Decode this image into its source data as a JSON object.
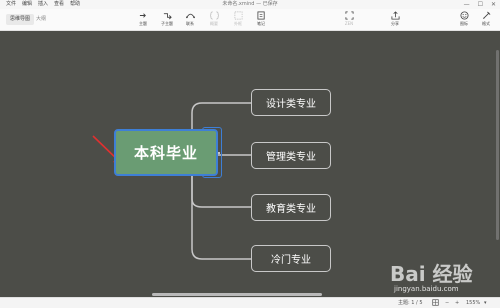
{
  "menubar": {
    "items": [
      "文件",
      "编辑",
      "插入",
      "查看",
      "帮助"
    ],
    "title": "未命名.xmind — 已保存",
    "controls": {
      "minimize": "—",
      "maximize": "☐",
      "close": "✕"
    }
  },
  "toolbar": {
    "view_tabs": [
      "思维导图",
      "大纲"
    ],
    "tools": [
      {
        "label": "主题",
        "icon": "topic-icon",
        "enabled": true
      },
      {
        "label": "子主题",
        "icon": "subtopic-icon",
        "enabled": true
      },
      {
        "label": "联系",
        "icon": "relationship-icon",
        "enabled": true
      },
      {
        "label": "概要",
        "icon": "summary-icon",
        "enabled": false
      },
      {
        "label": "外框",
        "icon": "boundary-icon",
        "enabled": false
      },
      {
        "label": "笔记",
        "icon": "note-icon",
        "enabled": true
      },
      {
        "label": "ZEN",
        "icon": "zen-icon",
        "enabled": false
      },
      {
        "label": "分享",
        "icon": "share-icon",
        "enabled": true
      },
      {
        "label": "图标",
        "icon": "icon-panel-icon",
        "enabled": true
      },
      {
        "label": "格式",
        "icon": "format-icon",
        "enabled": true
      }
    ]
  },
  "map": {
    "central": "本科毕业",
    "subtopics": [
      "设计类专业",
      "管理类专业",
      "教育类专业",
      "冷门专业"
    ],
    "colors": {
      "canvas": "#4c4d48",
      "central": "#6a9c73",
      "selection": "#3e7fd6",
      "arrow": "#e03030"
    }
  },
  "statusbar": {
    "topic_count": "主题: 1 / 5",
    "zoom": "155%",
    "zoom_out": "−",
    "zoom_in": "+",
    "zoom_chevron": "▾"
  },
  "watermark": {
    "logo": "Bai 经验",
    "url": "jingyan.baidu.com"
  }
}
